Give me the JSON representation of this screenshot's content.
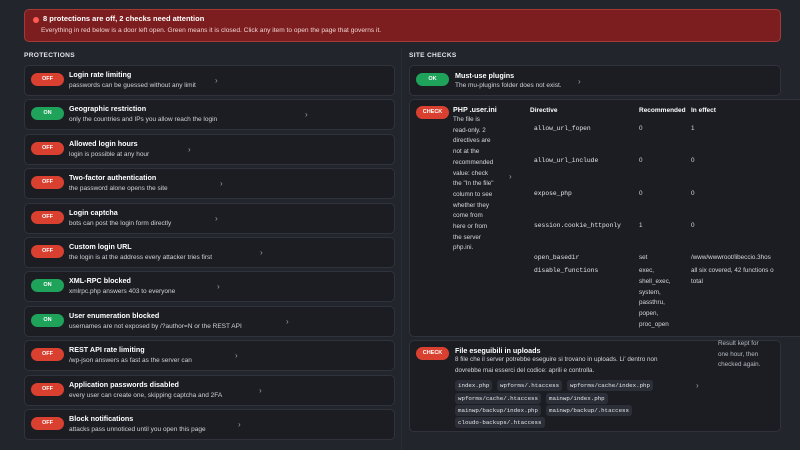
{
  "banner": {
    "title": "8 protections are off, 2 checks need attention",
    "subtitle": "Everything in red below is a door left open. Green means it is closed. Click any item to open the page that governs it.",
    "color": "#7c1d1f"
  },
  "protections": {
    "heading": "PROTECTIONS",
    "items": [
      {
        "status": "OFF",
        "title": "Login rate limiting",
        "desc": "passwords can be guessed without any limit"
      },
      {
        "status": "ON",
        "title": "Geographic restriction",
        "desc": "only the countries and IPs you allow reach the login"
      },
      {
        "status": "OFF",
        "title": "Allowed login hours",
        "desc": "login is possible at any hour"
      },
      {
        "status": "OFF",
        "title": "Two-factor authentication",
        "desc": "the password alone opens the site"
      },
      {
        "status": "OFF",
        "title": "Login captcha",
        "desc": "bots can post the login form directly"
      },
      {
        "status": "OFF",
        "title": "Custom login URL",
        "desc": "the login is at the address every attacker tries first"
      },
      {
        "status": "ON",
        "title": "XML-RPC blocked",
        "desc": "xmlrpc.php answers 403 to everyone"
      },
      {
        "status": "ON",
        "title": "User enumeration blocked",
        "desc": "usernames are not exposed by /?author=N or the REST API"
      },
      {
        "status": "OFF",
        "title": "REST API rate limiting",
        "desc": "/wp-json answers as fast as the server can"
      },
      {
        "status": "OFF",
        "title": "Application passwords disabled",
        "desc": "every user can create one, skipping captcha and 2FA"
      },
      {
        "status": "OFF",
        "title": "Block notifications",
        "desc": "attacks pass unnoticed until you open this page"
      }
    ]
  },
  "site_checks": {
    "heading": "SITE CHECKS",
    "mu_plugins": {
      "status": "OK",
      "title": "Must-use plugins",
      "desc": "The mu-plugins folder does not exist."
    },
    "user_ini": {
      "status": "CHECK",
      "title": "PHP .user.ini",
      "desc_lines": [
        "The file is",
        "read-only. 2",
        "directives are",
        "not at the",
        "recommended",
        "value: check",
        "the \"In the file\"",
        "column to see",
        "whether they",
        "come from",
        "here or from",
        "the server",
        "php.ini."
      ],
      "columns": {
        "directive": "Directive",
        "recommended": "Recommended",
        "in_effect": "In effect"
      },
      "rows": [
        {
          "directive": "allow_url_fopen",
          "recommended": "0",
          "in_effect": "1"
        },
        {
          "directive": "allow_url_include",
          "recommended": "0",
          "in_effect": "0"
        },
        {
          "directive": "expose_php",
          "recommended": "0",
          "in_effect": "0"
        },
        {
          "directive": "session.cookie_httponly",
          "recommended": "1",
          "in_effect": "0"
        },
        {
          "directive": "open_basedir",
          "recommended": "set",
          "in_effect": "/www/wwwroot/libeccio.3hos"
        },
        {
          "directive": "disable_functions",
          "recommended_lines": [
            "exec,",
            "shell_exec,",
            "system,",
            "passthru,",
            "popen,",
            "proc_open"
          ],
          "in_effect_lines": [
            "all six covered, 42 functions o",
            "total"
          ]
        }
      ]
    },
    "uploads": {
      "status": "CHECK",
      "title": "File eseguibili in uploads",
      "desc_lines": [
        "8 file che il server potrebbe eseguire si trovano in uploads. Li' dentro non",
        "dovrebbe mai esserci del codice: aprili e controlla."
      ],
      "files": [
        "index.php",
        "wpforms/.htaccess",
        "wpforms/cache/index.php",
        "wpforms/cache/.htaccess",
        "mainwp/index.php",
        "mainwp/backup/index.php",
        "mainwp/backup/.htaccess",
        "cloudo-backups/.htaccess"
      ],
      "note_lines": [
        "Result kept for",
        "one hour, then",
        "checked again."
      ]
    }
  },
  "icons": {
    "status_dot": "alert-dot-icon",
    "chevron": "chevron-right-icon"
  },
  "colors": {
    "off": "#d9402f",
    "on": "#1fa25a",
    "background": "#23252c"
  }
}
